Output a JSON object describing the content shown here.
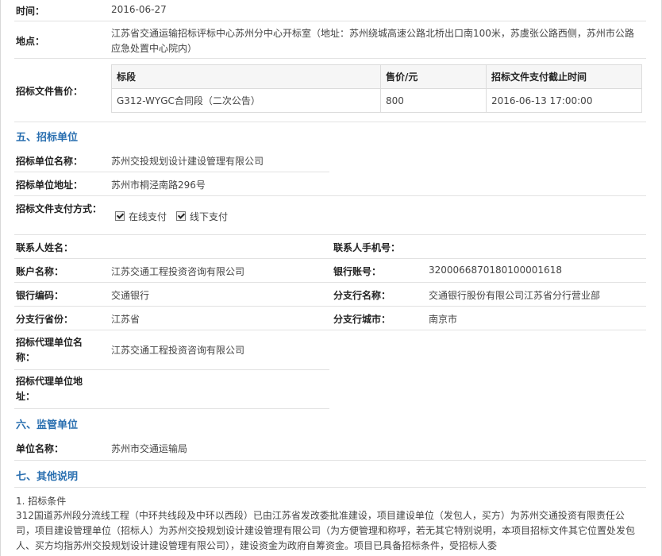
{
  "info": {
    "time_label": "时间：",
    "time_value": "2016-06-27",
    "place_label": "地点：",
    "place_value": "江苏省交通运输招标评标中心苏州分中心开标室（地址：苏州绕城高速公路北桥出口南100米，苏虞张公路西侧，苏州市公路应急处置中心院内）",
    "fee_label": "招标文件售价："
  },
  "fee_table": {
    "headers": [
      "标段",
      "售价/元",
      "招标文件支付截止时间"
    ],
    "rows": [
      [
        "G312-WYGC合同段（二次公告）",
        "800",
        "2016-06-13 17:00:00"
      ]
    ]
  },
  "sections": {
    "s5": "五、招标单位",
    "s6": "六、监管单位",
    "s7": "七、其他说明"
  },
  "tenderer": {
    "name_label": "招标单位名称：",
    "name_value": "苏州交投规划设计建设管理有限公司",
    "addr_label": "招标单位地址：",
    "addr_value": "苏州市桐泾南路296号",
    "pay_label": "招标文件支付方式：",
    "pay_online": "在线支付",
    "pay_offline": "线下支付",
    "contact_label": "联系人姓名：",
    "contact_value": "",
    "mobile_label": "联系人手机号：",
    "mobile_value": "",
    "account_label": "账户名称：",
    "account_value": "江苏交通工程投资咨询有限公司",
    "bank_no_label": "银行账号：",
    "bank_no_value": "3200066870180100001618",
    "bank_code_label": "银行编码：",
    "bank_code_value": "交通银行",
    "branch_label": "分支行名称：",
    "branch_value": "交通银行股份有限公司江苏省分行营业部",
    "province_label": "分支行省份：",
    "province_value": "江苏省",
    "city_label": "分支行城市：",
    "city_value": "南京市",
    "agent_name_label": "招标代理单位名称：",
    "agent_name_value": "江苏交通工程投资咨询有限公司",
    "agent_addr_label": "招标代理单位地址：",
    "agent_addr_value": ""
  },
  "supervisor": {
    "name_label": "单位名称：",
    "name_value": "苏州市交通运输局"
  },
  "notes": {
    "item1_title": "1. 招标条件",
    "item1_text": "312国道苏州段分流线工程（中环共线段及中环以西段）已由江苏省发改委批准建设，项目建设单位（发包人，买方）为苏州交通投资有限责任公司，项目建设管理单位（招标人）为苏州交投规划设计建设管理有限公司（为方便管理和称呼，若无其它特别说明，本项目招标文件其它位置处发包人、买方均指苏州交投规划设计建设管理有限公司），建设资金为政府自筹资金。项目已具备招标条件，受招标人委"
  }
}
